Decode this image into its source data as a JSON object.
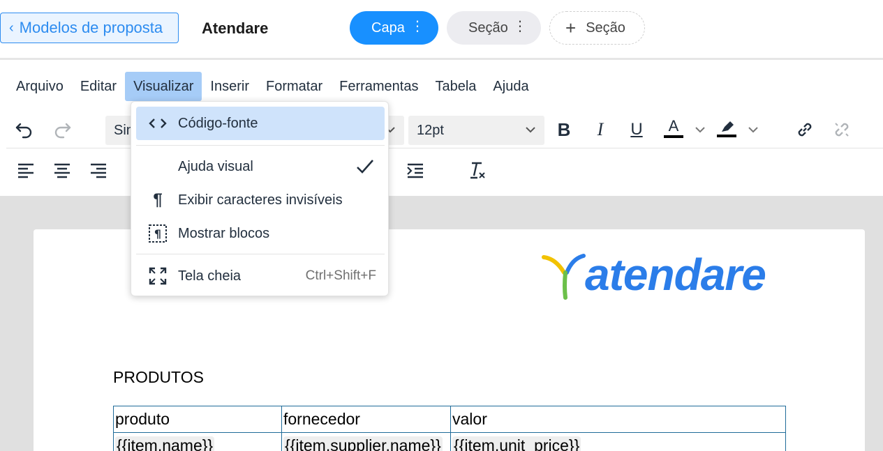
{
  "header": {
    "back_label": "Modelos de proposta",
    "title": "Atendare",
    "pills": {
      "capa": "Capa",
      "secao": "Seção",
      "add_secao": "Seção"
    }
  },
  "menubar": [
    "Arquivo",
    "Editar",
    "Visualizar",
    "Inserir",
    "Formatar",
    "Ferramentas",
    "Tabela",
    "Ajuda"
  ],
  "toolbar": {
    "font_family_visible": "Sin",
    "font_size": "12pt"
  },
  "view_menu": {
    "items": [
      {
        "label": "Código-fonte",
        "icon": "code-icon",
        "highlighted": true
      },
      {
        "label": "Ajuda visual",
        "icon": "",
        "checked": true
      },
      {
        "label": "Exibir caracteres invisíveis",
        "icon": "pilcrow-icon"
      },
      {
        "label": "Mostrar blocos",
        "icon": "show-blocks-icon"
      },
      {
        "label": "Tela cheia",
        "icon": "fullscreen-icon",
        "shortcut": "Ctrl+Shift+F"
      }
    ]
  },
  "document": {
    "logo_text": "atendare",
    "section_title": "PRODUTOS",
    "table": {
      "headers": [
        "produto",
        "fornecedor",
        "valor"
      ],
      "rows": [
        [
          "{{item.name}}",
          "{{item.supplier.name}}",
          "{{item.unit_price}}"
        ]
      ]
    }
  },
  "colors": {
    "accent": "#1890ff",
    "menu_active": "#a6ccf7",
    "logo_blue": "#2b7de9",
    "logo_yellow": "#f2c200",
    "logo_green": "#6cc04a"
  }
}
